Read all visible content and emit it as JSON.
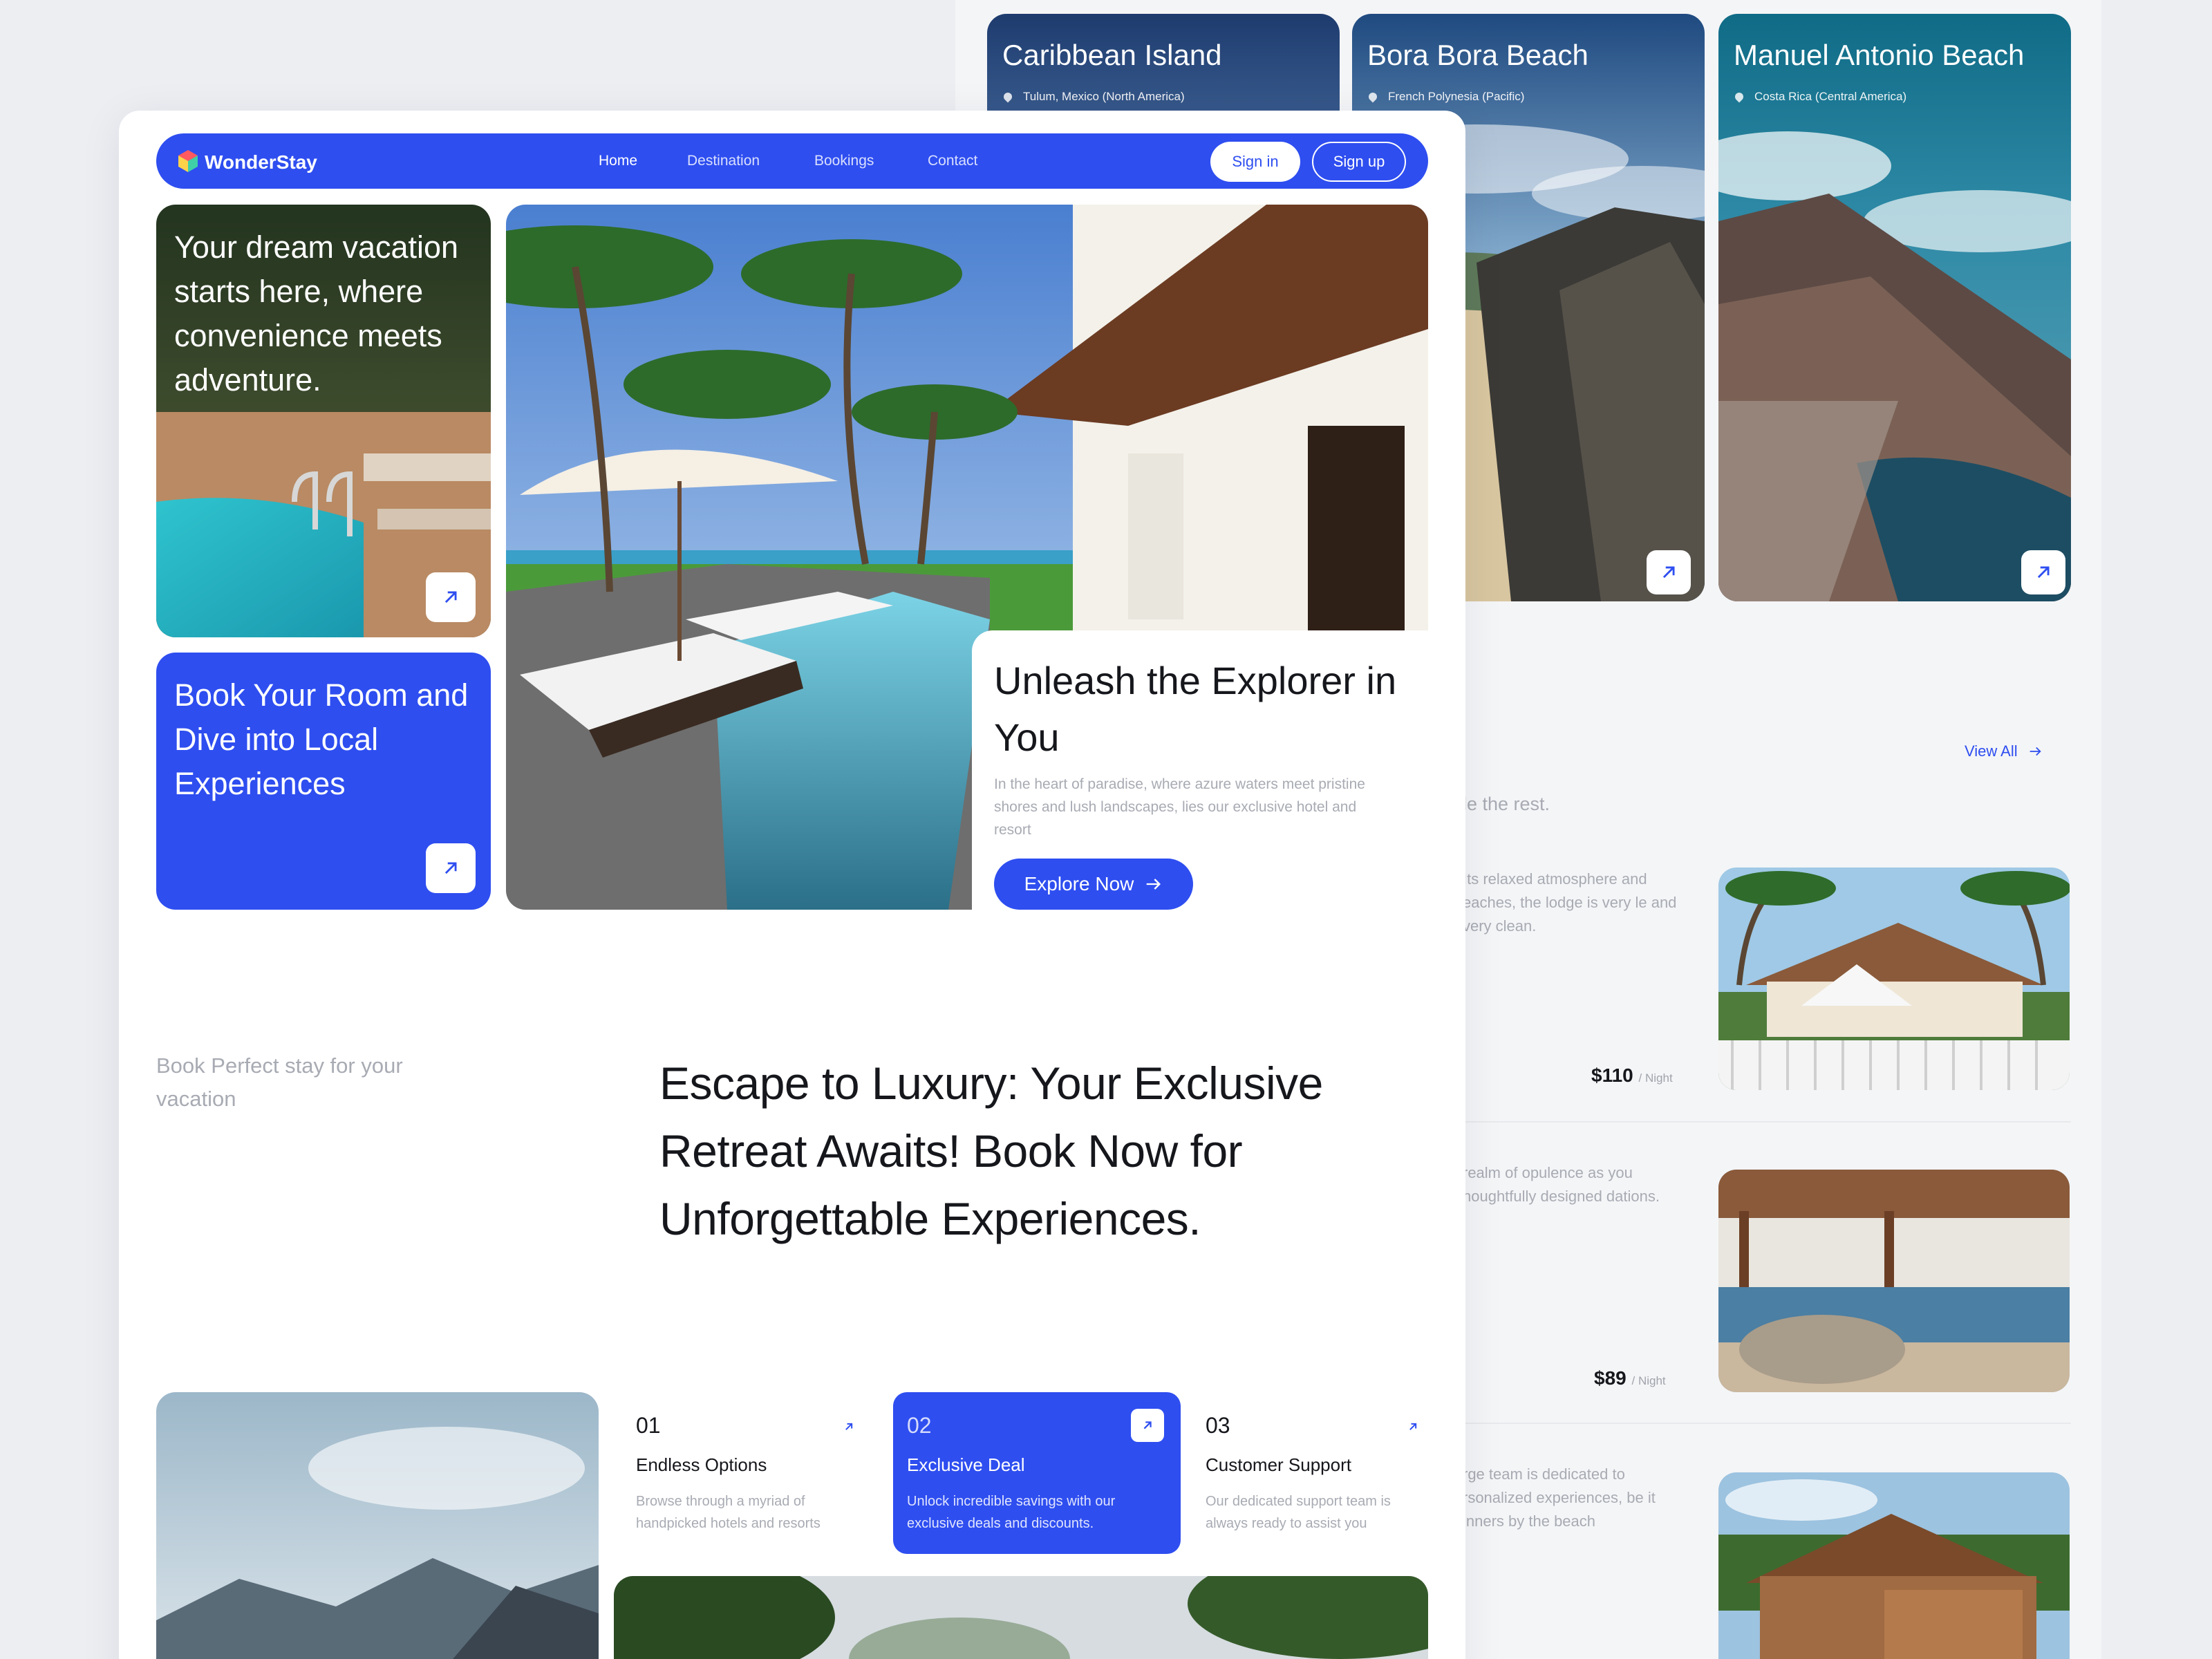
{
  "brand": {
    "name": "WonderStay"
  },
  "nav": {
    "items": [
      {
        "label": "Home",
        "active": true
      },
      {
        "label": "Destination",
        "active": false
      },
      {
        "label": "Bookings",
        "active": false
      },
      {
        "label": "Contact",
        "active": false
      }
    ],
    "sign_in": "Sign in",
    "sign_up": "Sign up"
  },
  "hero": {
    "card_top_text": "Your dream vacation starts here, where convenience meets adventure.",
    "card_bottom_text": "Book Your Room and Dive into Local Experiences",
    "headline": "Unleash the Explorer in You",
    "subtext": "In the heart of paradise, where azure waters meet pristine shores and lush landscapes, lies our exclusive hotel and resort",
    "cta": "Explore Now"
  },
  "intro": {
    "side_label": "Book Perfect stay for your vacation",
    "headline": "Escape to Luxury: Your Exclusive Retreat Awaits! Book Now for Unforgettable Experiences."
  },
  "features": [
    {
      "num": "01",
      "title": "Endless Options",
      "desc": "Browse through a myriad of handpicked hotels and resorts",
      "highlighted": false
    },
    {
      "num": "02",
      "title": "Exclusive Deal",
      "desc": "Unlock incredible savings with our exclusive deals and discounts.",
      "highlighted": true
    },
    {
      "num": "03",
      "title": "Customer Support",
      "desc": "Our dedicated support team is always ready to assist you",
      "highlighted": false
    }
  ],
  "destinations": [
    {
      "name": "Caribbean Island",
      "location": "Tulum, Mexico (North America)"
    },
    {
      "name": "Bora Bora Beach",
      "location": "French Polynesia (Pacific)"
    },
    {
      "name": "Manuel Antonio Beach",
      "location": "Costa Rica (Central America)"
    }
  ],
  "hotels_section": {
    "view_all": "View All",
    "subtitle_fragment": "ile the rest.",
    "items": [
      {
        "desc_fragment": "Its relaxed atmosphere and eaches, the lodge is very le and very clean.",
        "price": "$110",
        "unit": "/ Night"
      },
      {
        "desc_fragment": "realm of opulence as you houghtfully designed dations.",
        "price": "$89",
        "unit": "/ Night"
      },
      {
        "desc_fragment": "rge team is dedicated to rsonalized experiences, be it inners by the beach",
        "price": "",
        "unit": ""
      }
    ]
  },
  "colors": {
    "accent": "#2e4ef0",
    "text": "#16171c",
    "muted": "#a8abb3",
    "background": "#eceef2"
  },
  "icons": [
    "logo-cube-icon",
    "arrow-up-right-icon",
    "arrow-right-icon",
    "location-pin-icon"
  ]
}
